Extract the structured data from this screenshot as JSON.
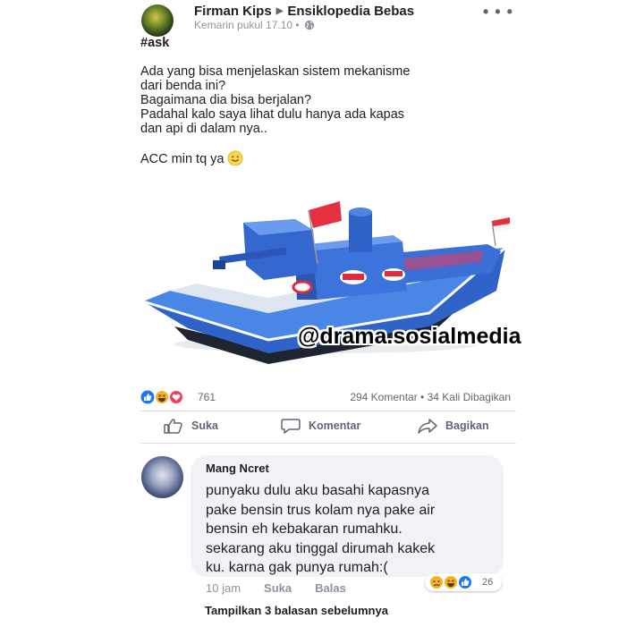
{
  "post": {
    "author": "Firman Kips",
    "group": "Ensiklopedia Bebas",
    "timestamp": "Kemarin pukul 17.10",
    "separator": "•",
    "text": {
      "hashtag": "#ask",
      "lines": [
        "Ada yang bisa menjelaskan sistem mekanisme",
        "dari benda ini?",
        "Bagaimana dia bisa berjalan?",
        "Padahal kalo saya lihat dulu hanya ada kapas",
        "dan api di dalam nya.."
      ],
      "closing": "ACC min tq ya"
    },
    "watermark": "@drama.sosialmedia",
    "reactions": {
      "count": "761",
      "types": [
        "like",
        "haha",
        "love"
      ]
    },
    "stats": {
      "comments": "294 Komentar",
      "bullet": "•",
      "shares": "34 Kali Dibagikan"
    },
    "actions": {
      "like": "Suka",
      "comment": "Komentar",
      "share": "Bagikan"
    }
  },
  "comment": {
    "author": "Mang Ncret",
    "lines": [
      "punyaku dulu aku basahi kapasnya",
      "pake bensin trus kolam nya pake air",
      "bensin eh kebakaran rumahku.",
      "sekarang aku tinggal dirumah kakek",
      "ku. karna gak punya rumah:("
    ],
    "time": "10 jam",
    "like": "Suka",
    "reply": "Balas",
    "reactions": {
      "count": "26",
      "types": [
        "sad",
        "haha",
        "like"
      ]
    },
    "more_replies": "Tampilkan 3 balasan sebelumnya"
  },
  "colors": {
    "boat_blue": "#2f63c8",
    "like_blue": "#1877f2",
    "love_red": "#f33e58",
    "haha_yellow": "#f7b125"
  }
}
